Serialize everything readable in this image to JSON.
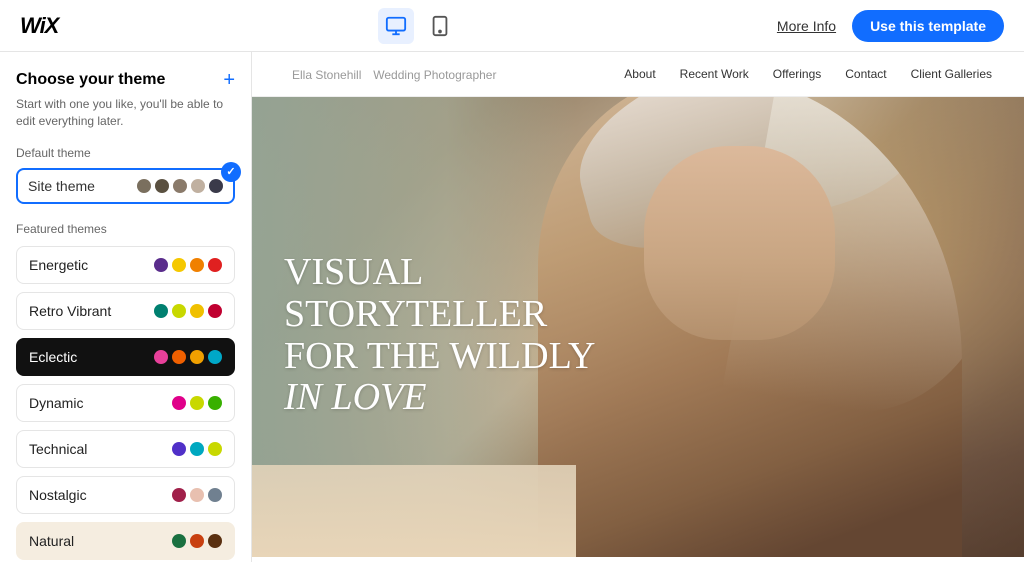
{
  "topbar": {
    "logo": "WiX",
    "more_info_label": "More Info",
    "use_template_label": "Use this template"
  },
  "sidebar": {
    "title": "Choose your theme",
    "subtitle": "Start with one you like, you'll be able to edit everything later.",
    "add_icon": "+",
    "default_theme_section": "Default theme",
    "default_theme_label": "Site theme",
    "default_theme_colors": [
      {
        "color": "#7a6f5e"
      },
      {
        "color": "#5a5040"
      },
      {
        "color": "#8a7a6a"
      },
      {
        "color": "#c0b0a0"
      },
      {
        "color": "#3a3a4a"
      }
    ],
    "featured_label": "Featured themes",
    "themes": [
      {
        "name": "Energetic",
        "colors": [
          "#5a2d8c",
          "#f5c800",
          "#f08000",
          "#e02020"
        ],
        "selected": false,
        "bg": "white"
      },
      {
        "name": "Retro Vibrant",
        "colors": [
          "#008070",
          "#c8d800",
          "#f0c000",
          "#c00030"
        ],
        "selected": false,
        "bg": "white"
      },
      {
        "name": "Eclectic",
        "colors": [
          "#e8409a",
          "#f06000",
          "#f0a000",
          "#00a8c8"
        ],
        "selected": true,
        "bg": "black"
      },
      {
        "name": "Dynamic",
        "colors": [
          "#e0008a",
          "#c8d800",
          "#38b000"
        ],
        "selected": false,
        "bg": "white"
      },
      {
        "name": "Technical",
        "colors": [
          "#5030c8",
          "#00a8c0",
          "#c8d800"
        ],
        "selected": false,
        "bg": "white"
      },
      {
        "name": "Nostalgic",
        "colors": [
          "#a0204a",
          "#e8c0b0",
          "#708090"
        ],
        "selected": false,
        "bg": "white"
      },
      {
        "name": "Natural",
        "colors": [
          "#1a7040",
          "#c84010",
          "#5a3010"
        ],
        "selected": false,
        "bg": "#f5ede0"
      }
    ]
  },
  "preview": {
    "site_name": "Ella Stonehill",
    "site_tagline": "Wedding Photographer",
    "nav_items": [
      "About",
      "Recent Work",
      "Offerings",
      "Contact",
      "Client Galleries"
    ],
    "hero_line1": "VISUAL",
    "hero_line2": "STORYTELLER",
    "hero_line3": "FOR THE WILDLY",
    "hero_line4_italic": "IN LOVE"
  }
}
